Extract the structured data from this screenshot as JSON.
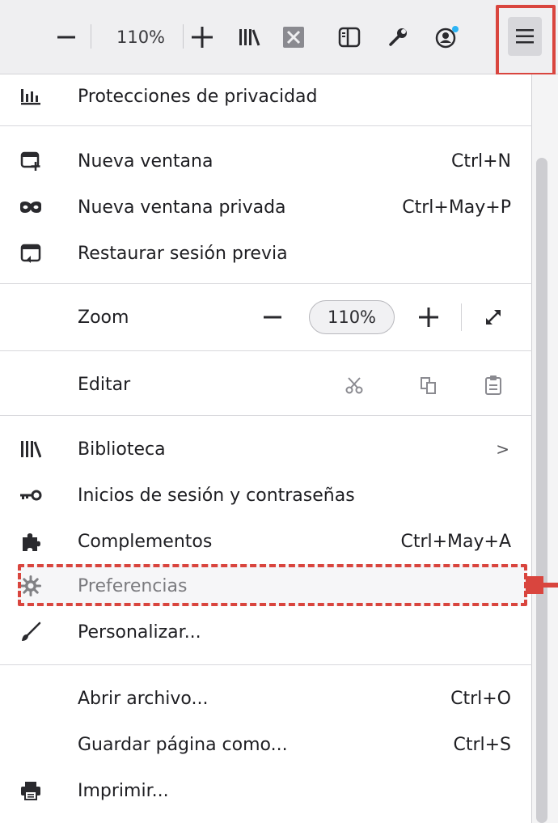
{
  "toolbar": {
    "zoom_level": "110%",
    "zoom_out_icon": "minus-icon",
    "zoom_in_icon": "plus-icon",
    "library_icon": "library-icon",
    "extension_icon": "x-box-icon",
    "sidebar_icon": "sidebar-icon",
    "devtools_icon": "wrench-icon",
    "account_icon": "account-icon",
    "menu_icon": "hamburger-icon"
  },
  "menu": {
    "privacy": {
      "label": "Protecciones de privacidad",
      "icon": "privacy-chart-icon"
    },
    "new_window": {
      "label": "Nueva ventana",
      "shortcut": "Ctrl+N",
      "icon": "new-window-icon"
    },
    "private_window": {
      "label": "Nueva ventana privada",
      "shortcut": "Ctrl+May+P",
      "icon": "mask-icon"
    },
    "restore_session": {
      "label": "Restaurar sesión previa",
      "icon": "restore-icon"
    },
    "zoom": {
      "label": "Zoom",
      "value": "110%"
    },
    "edit": {
      "label": "Editar"
    },
    "library": {
      "label": "Biblioteca",
      "chevron": ">",
      "icon": "library-icon"
    },
    "logins": {
      "label": "Inicios de sesión y contraseñas",
      "icon": "key-icon"
    },
    "addons": {
      "label": "Complementos",
      "shortcut": "Ctrl+May+A",
      "icon": "puzzle-icon"
    },
    "preferences": {
      "label": "Preferencias",
      "icon": "gear-icon"
    },
    "customize": {
      "label": "Personalizar...",
      "icon": "brush-icon"
    },
    "open_file": {
      "label": "Abrir archivo...",
      "shortcut": "Ctrl+O"
    },
    "save_page": {
      "label": "Guardar página como...",
      "shortcut": "Ctrl+S"
    },
    "print": {
      "label": "Imprimir...",
      "icon": "printer-icon"
    }
  },
  "colors": {
    "highlight": "#d9453e",
    "toolbar_bg": "#efeff1",
    "account_dot": "#2cb4f5"
  }
}
